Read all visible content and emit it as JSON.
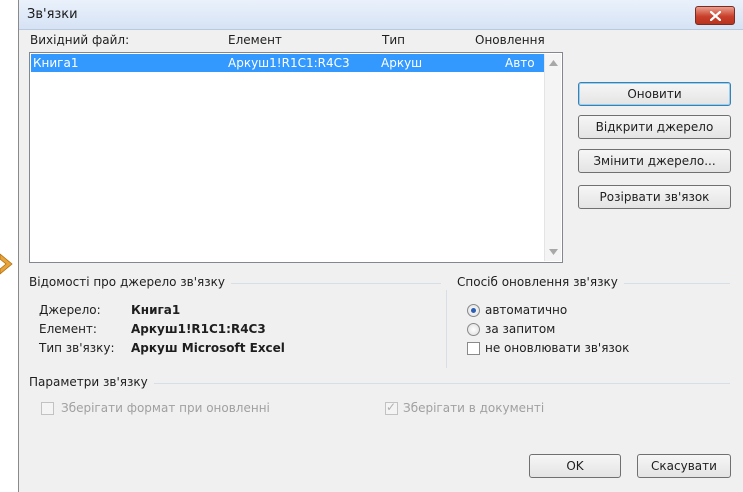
{
  "dialog": {
    "title": "Зв'язки"
  },
  "columns": {
    "source": "Вихідний файл:",
    "element": "Елемент",
    "type": "Тип",
    "update": "Оновлення"
  },
  "links": [
    {
      "source": "Книга1",
      "element": "Аркуш1!R1C1:R4C3",
      "type": "Аркуш",
      "update": "Авто",
      "selected": true
    }
  ],
  "buttons": {
    "update": "Оновити",
    "open_source": "Відкрити джерело",
    "change_source": "Змінити джерело...",
    "break_link": "Розірвати зв'язок",
    "ok": "OK",
    "cancel": "Скасувати"
  },
  "details": {
    "section_title": "Відомості про джерело зв'язку",
    "source_label": "Джерело:",
    "source_value": "Книга1",
    "element_label": "Елемент:",
    "element_value": "Аркуш1!R1C1:R4C3",
    "link_type_label": "Тип зв'язку:",
    "link_type_value": "Аркуш Microsoft Excel"
  },
  "update_method": {
    "section_title": "Спосіб оновлення зв'язку",
    "options": [
      {
        "label": "автоматично",
        "checked": true
      },
      {
        "label": "за запитом",
        "checked": false
      }
    ],
    "no_update_label": "не оновлювати зв'язок",
    "no_update_checked": false
  },
  "params": {
    "section_title": "Параметри зв'язку",
    "keep_format_label": "Зберігати формат при оновленні",
    "keep_format_checked": false,
    "keep_in_doc_label": "Зберігати в документі",
    "keep_in_doc_checked": true
  },
  "colors": {
    "selection": "#3399ff",
    "close_button": "#c9402b"
  },
  "icons": {
    "close": "close-icon",
    "scroll_up": "scroll-up-arrow-icon",
    "scroll_down": "scroll-down-arrow-icon",
    "edge_arrow": "arrow-right-icon"
  }
}
